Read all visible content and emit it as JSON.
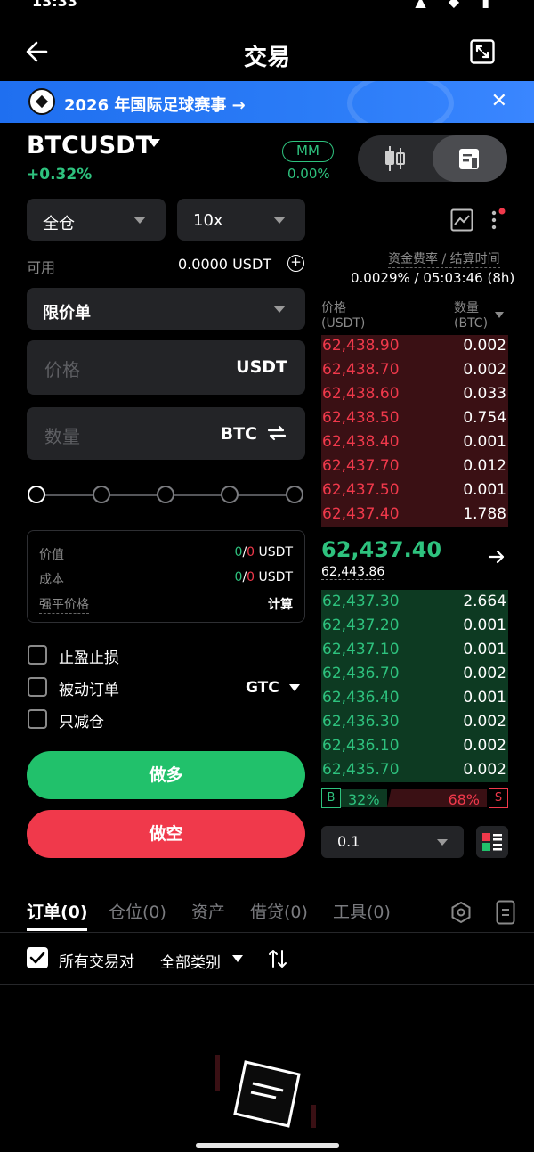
{
  "status_bar": {
    "time": "13:33",
    "icons": "▲ ◆ ▮"
  },
  "header": {
    "title": "交易"
  },
  "banner": {
    "text": "2026 年国际足球赛事 →"
  },
  "symbol": {
    "name": "BTCUSDT",
    "change": "+0.32%",
    "mm_label": "MM",
    "mm_value": "0.00%"
  },
  "form": {
    "margin_mode": "全仓",
    "leverage": "10x",
    "available_label": "可用",
    "available_value": "0.0000 USDT",
    "order_type": "限价单",
    "price_placeholder": "价格",
    "price_unit": "USDT",
    "qty_placeholder": "数量",
    "qty_unit": "BTC",
    "summary": {
      "value_label": "价值",
      "value_long": "0",
      "value_short": "0",
      "value_unit": "USDT",
      "cost_label": "成本",
      "cost_long": "0",
      "cost_short": "0",
      "cost_unit": "USDT",
      "liq_label": "强平价格",
      "liq_action": "计算"
    },
    "options": [
      {
        "label": "止盈止损"
      },
      {
        "label": "被动订单"
      },
      {
        "label": "只减仓"
      }
    ],
    "tif": "GTC",
    "long_button": "做多",
    "short_button": "做空"
  },
  "funding": {
    "label": "资金费率 / 结算时间",
    "value": "0.0029% / 05:03:46 (8h)"
  },
  "orderbook": {
    "price_header": "价格",
    "price_unit": "(USDT)",
    "qty_header": "数量",
    "qty_unit": "(BTC)",
    "asks": [
      {
        "price": "62,438.90",
        "qty": "0.002"
      },
      {
        "price": "62,438.70",
        "qty": "0.002"
      },
      {
        "price": "62,438.60",
        "qty": "0.033"
      },
      {
        "price": "62,438.50",
        "qty": "0.754"
      },
      {
        "price": "62,438.40",
        "qty": "0.001"
      },
      {
        "price": "62,437.70",
        "qty": "0.012"
      },
      {
        "price": "62,437.50",
        "qty": "0.001"
      },
      {
        "price": "62,437.40",
        "qty": "1.788"
      }
    ],
    "last_price": "62,437.40",
    "mark_price": "62,443.86",
    "bids": [
      {
        "price": "62,437.30",
        "qty": "2.664"
      },
      {
        "price": "62,437.20",
        "qty": "0.001"
      },
      {
        "price": "62,437.10",
        "qty": "0.001"
      },
      {
        "price": "62,436.70",
        "qty": "0.002"
      },
      {
        "price": "62,436.40",
        "qty": "0.001"
      },
      {
        "price": "62,436.30",
        "qty": "0.002"
      },
      {
        "price": "62,436.10",
        "qty": "0.002"
      },
      {
        "price": "62,435.70",
        "qty": "0.002"
      }
    ],
    "buy_label": "B",
    "buy_pct": "32%",
    "sell_pct": "68%",
    "sell_label": "S",
    "precision": "0.1"
  },
  "tabs": [
    {
      "label": "订单(0)"
    },
    {
      "label": "仓位(0)"
    },
    {
      "label": "资产"
    },
    {
      "label": "借贷(0)"
    },
    {
      "label": "工具(0)"
    }
  ],
  "filters": {
    "all_pairs": "所有交易对",
    "category": "全部类别"
  },
  "colors": {
    "green": "#21c16b",
    "red": "#f0394b",
    "banner_blue": "#2b7cf7"
  }
}
